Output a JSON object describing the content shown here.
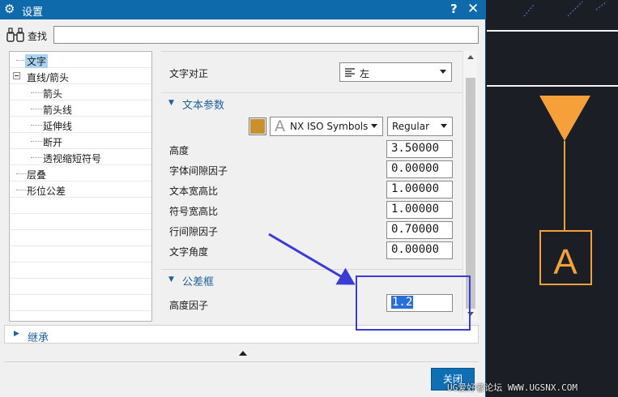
{
  "window": {
    "title": "设置",
    "help": "?",
    "close": "✕"
  },
  "find": {
    "label": "查找",
    "value": ""
  },
  "tree": {
    "items": [
      {
        "label": "文字",
        "selected": true
      },
      {
        "label": "直线/箭头",
        "expanded": true
      },
      {
        "label": "箭头"
      },
      {
        "label": "箭头线"
      },
      {
        "label": "延伸线"
      },
      {
        "label": "断开"
      },
      {
        "label": "透视缩短符号"
      },
      {
        "label": "层叠"
      },
      {
        "label": "形位公差"
      }
    ]
  },
  "panel": {
    "text_align": {
      "label": "文字对正",
      "value": "左"
    },
    "text_params": {
      "title": "文本参数",
      "font": {
        "color": "#c8912e",
        "name": "NX ISO Symbols",
        "style": "Regular"
      },
      "rows": [
        {
          "label": "高度",
          "value": "3.50000"
        },
        {
          "label": "字体间隙因子",
          "value": "0.00000"
        },
        {
          "label": "文本宽高比",
          "value": "1.00000"
        },
        {
          "label": "符号宽高比",
          "value": "1.00000"
        },
        {
          "label": "行间隙因子",
          "value": "0.70000"
        },
        {
          "label": "文字角度",
          "value": "0.00000"
        }
      ]
    },
    "tolerance_frame": {
      "title": "公差框",
      "height_factor": {
        "label": "高度因子",
        "value": "1.2"
      }
    }
  },
  "inherit": {
    "title": "继承"
  },
  "footer": {
    "close_label": "关闭"
  },
  "canvas": {
    "datum_letter": "A",
    "accent": "#f5a03a"
  },
  "watermark": "UG爱好者论坛 WWW.UGSNX.COM"
}
